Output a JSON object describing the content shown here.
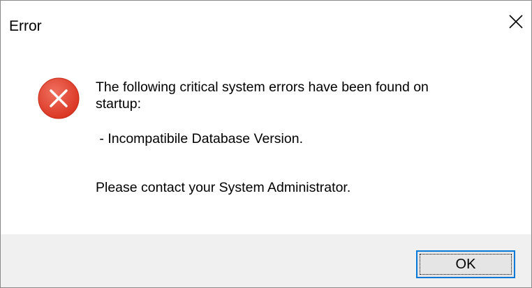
{
  "window": {
    "title": "Error"
  },
  "icons": {
    "close": "close-icon",
    "error": "error-icon"
  },
  "colors": {
    "error_icon_fill": "#e74c3c",
    "accent_border": "#0078d7",
    "footer_background": "#f0f0f0"
  },
  "message": {
    "line1": "The following critical system errors have been found on",
    "line2": "startup:",
    "error_item": " - Incompatibile Database Version.",
    "contact": "Please contact your System Administrator."
  },
  "buttons": {
    "ok_label": "OK"
  }
}
